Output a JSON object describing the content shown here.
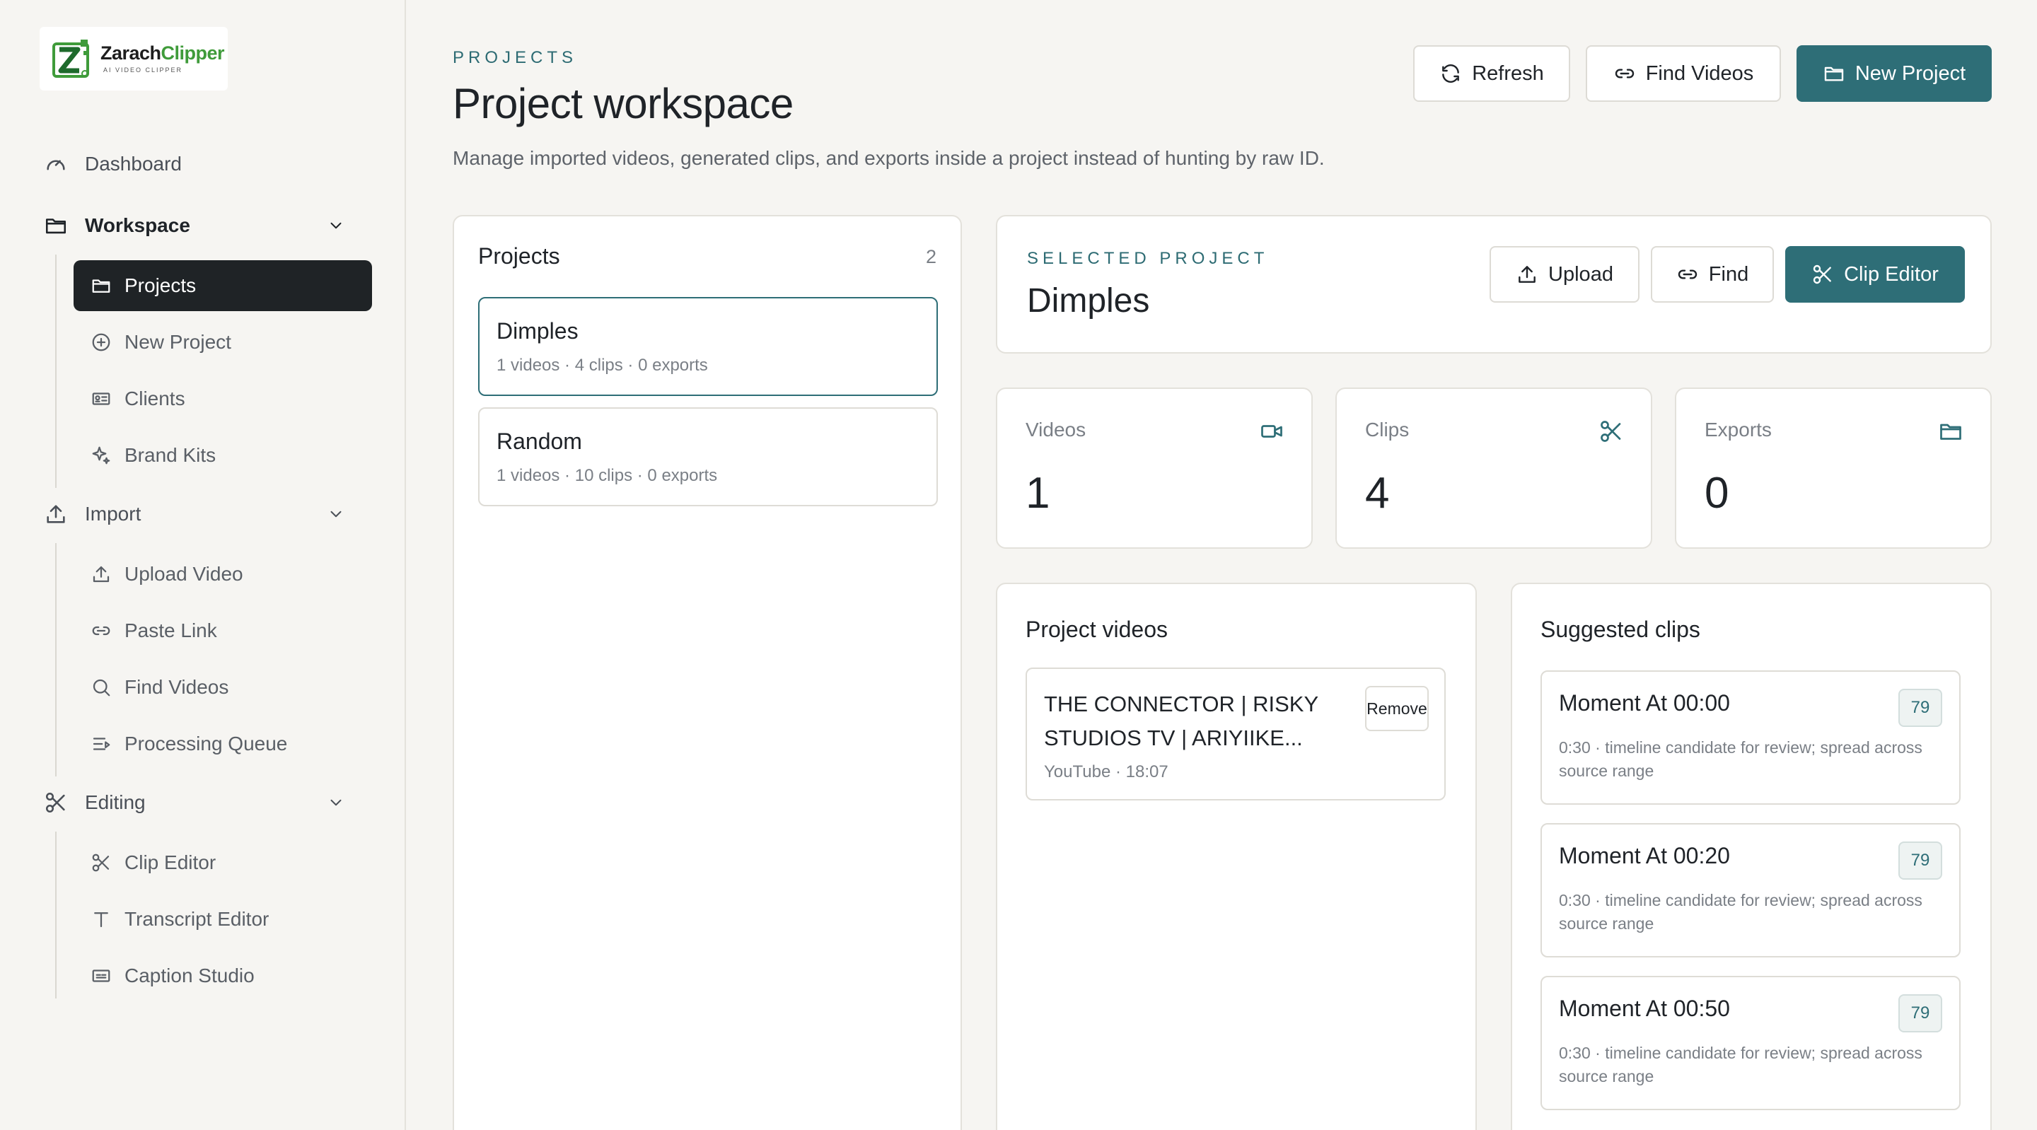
{
  "brand": {
    "name_part1": "Zarach",
    "name_part2": "Clipper",
    "tagline": "AI VIDEO CLIPPER",
    "accent": "#2e6e77",
    "logo_green": "#3f9b3a"
  },
  "sidebar": {
    "dashboard": {
      "label": "Dashboard",
      "icon": "gauge-icon"
    },
    "groups": [
      {
        "label": "Workspace",
        "icon": "folder-icon",
        "items": [
          {
            "label": "Projects",
            "icon": "folder-icon",
            "active": true
          },
          {
            "label": "New Project",
            "icon": "plus-circle-icon"
          },
          {
            "label": "Clients",
            "icon": "id-card-icon"
          },
          {
            "label": "Brand Kits",
            "icon": "sparkle-icon"
          }
        ]
      },
      {
        "label": "Import",
        "icon": "upload-icon",
        "items": [
          {
            "label": "Upload Video",
            "icon": "upload-icon"
          },
          {
            "label": "Paste Link",
            "icon": "link-icon"
          },
          {
            "label": "Find Videos",
            "icon": "search-icon"
          },
          {
            "label": "Processing Queue",
            "icon": "queue-icon"
          }
        ]
      },
      {
        "label": "Editing",
        "icon": "scissors-icon",
        "items": [
          {
            "label": "Clip Editor",
            "icon": "scissors-icon"
          },
          {
            "label": "Transcript Editor",
            "icon": "text-icon"
          },
          {
            "label": "Caption Studio",
            "icon": "caption-icon"
          }
        ]
      }
    ]
  },
  "header": {
    "eyebrow": "PROJECTS",
    "title": "Project workspace",
    "description": "Manage imported videos, generated clips, and exports inside a project instead of hunting by raw ID.",
    "refresh_label": "Refresh",
    "find_videos_label": "Find Videos",
    "new_project_label": "New Project"
  },
  "projects_panel": {
    "title": "Projects",
    "count": "2",
    "items": [
      {
        "name": "Dimples",
        "meta": "1 videos · 4 clips · 0 exports",
        "selected": true
      },
      {
        "name": "Random",
        "meta": "1 videos · 10 clips · 0 exports",
        "selected": false
      }
    ]
  },
  "selected_project": {
    "eyebrow": "SELECTED PROJECT",
    "name": "Dimples",
    "upload_label": "Upload",
    "find_label": "Find",
    "clip_editor_label": "Clip Editor"
  },
  "stats": [
    {
      "label": "Videos",
      "value": "1",
      "icon": "video-icon"
    },
    {
      "label": "Clips",
      "value": "4",
      "icon": "scissors-icon"
    },
    {
      "label": "Exports",
      "value": "0",
      "icon": "folder-icon"
    }
  ],
  "project_videos": {
    "title": "Project videos",
    "items": [
      {
        "title": "THE CONNECTOR | RISKY STUDIOS TV | ARIYIIKE...",
        "meta": "YouTube · 18:07",
        "remove_label": "Remove"
      }
    ]
  },
  "suggested_clips": {
    "title": "Suggested clips",
    "items": [
      {
        "title": "Moment At 00:00",
        "score": "79",
        "desc": "0:30 · timeline candidate for review; spread across source range"
      },
      {
        "title": "Moment At 00:20",
        "score": "79",
        "desc": "0:30 · timeline candidate for review; spread across source range"
      },
      {
        "title": "Moment At 00:50",
        "score": "79",
        "desc": "0:30 · timeline candidate for review; spread across source range"
      }
    ]
  }
}
